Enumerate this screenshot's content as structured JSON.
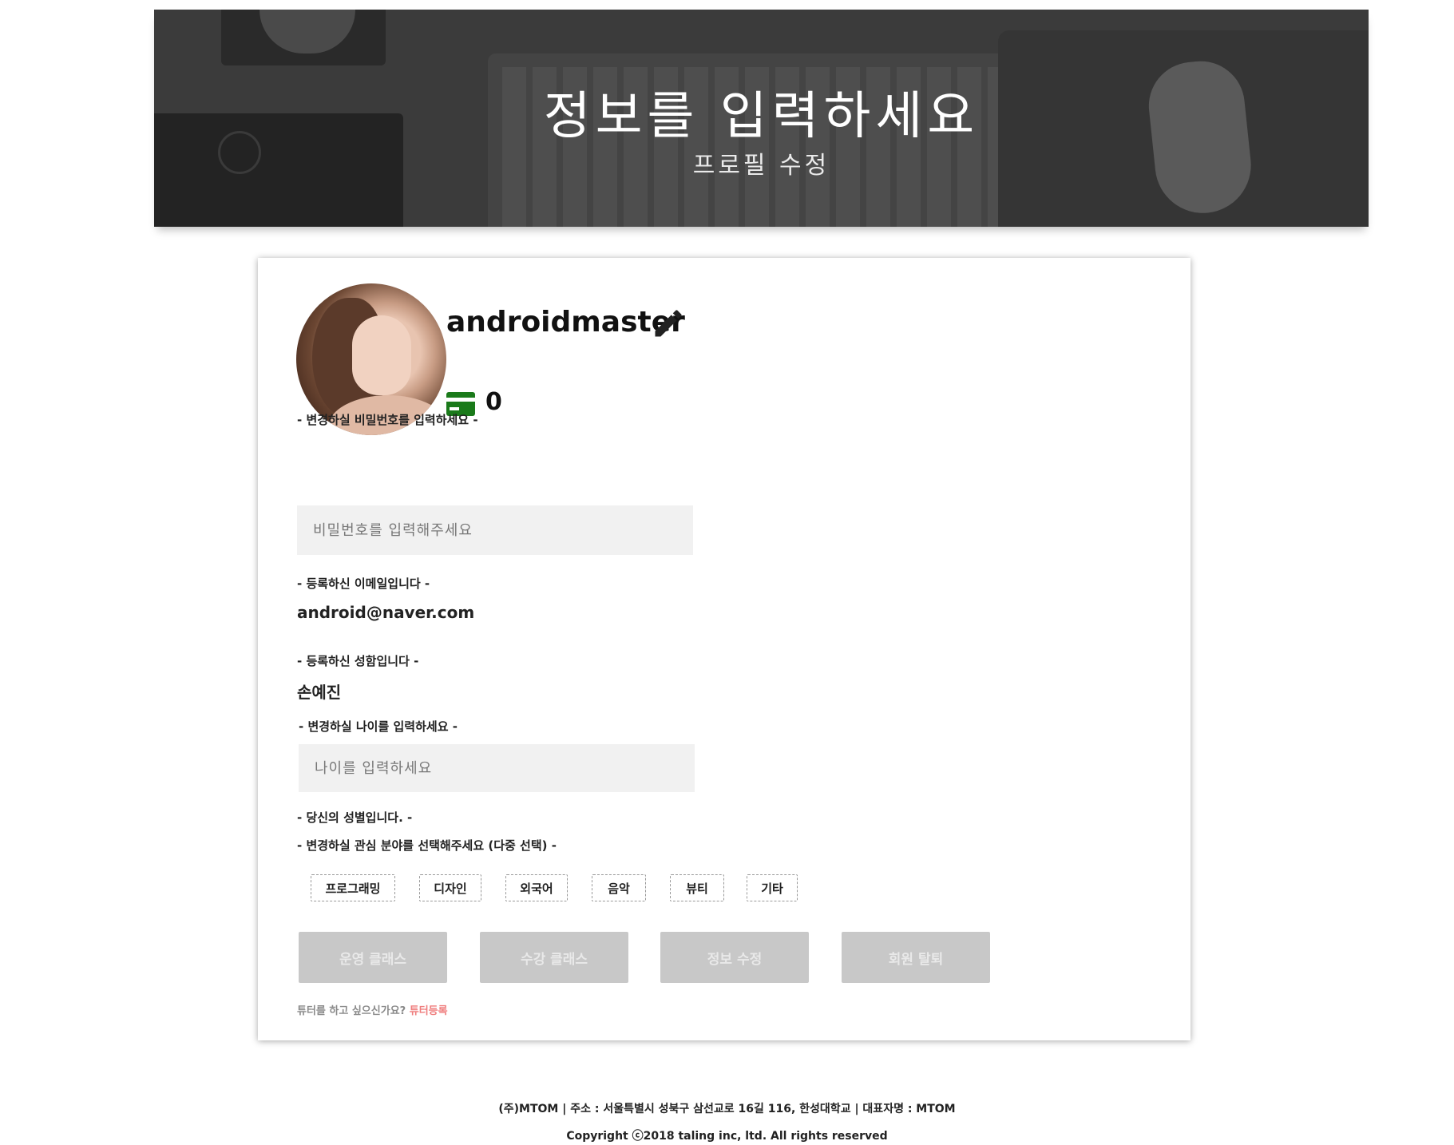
{
  "banner": {
    "title": "정보를 입력하세요",
    "subtitle": "프로필 수정"
  },
  "profile": {
    "username": "androidmaster",
    "points": "0",
    "edit_icon": "pencil-icon",
    "points_icon": "credit-card-icon",
    "points_icon_color": "#1a7a1a"
  },
  "form": {
    "password_label": "- 변경하실 비밀번호를 입력하세요 -",
    "password_placeholder": "비밀번호를 입력해주세요",
    "email_label": "- 등록하신 이메일입니다 -",
    "email_value": "android@naver.com",
    "name_label": "- 등록하신 성함입니다 -",
    "name_value": "손예진",
    "age_label": "- 변경하실 나이를 입력하세요 -",
    "age_placeholder": "나이를 입력하세요",
    "gender_label": "- 당신의 성별입니다. -",
    "interest_label": "- 변경하실 관심 분야를 선택해주세요 (다중 선택) -",
    "interests": [
      "프로그래밍",
      "디자인",
      "외국어",
      "음악",
      "뷰티",
      "기타"
    ]
  },
  "actions": {
    "buttons": [
      "운영 클래스",
      "수강 클래스",
      "정보 수정",
      "회원 탈퇴"
    ],
    "button_color": "#c8c8c8"
  },
  "tutor": {
    "question": "튜터를 하고 싶으신가요?",
    "link": "튜터등록",
    "link_color": "#ef7d7d"
  },
  "footer": {
    "line1": "(주)MTOM | 주소 : 서울특별시 성북구 삼선교로 16길 116, 한성대학교 | 대표자명 : MTOM",
    "line2": "Copyright ⓒ2018 taling inc, ltd. All rights reserved"
  }
}
